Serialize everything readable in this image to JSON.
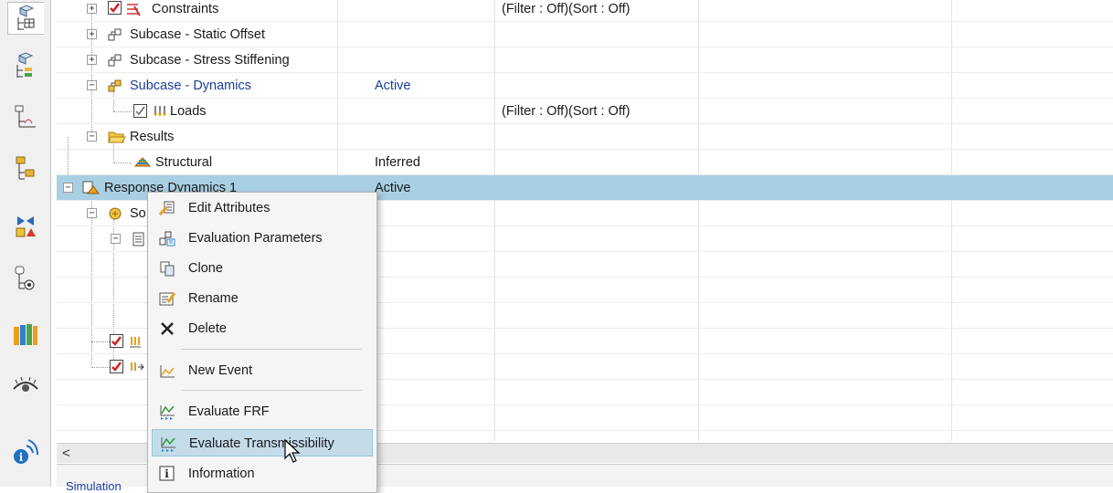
{
  "resource_bar": {
    "icons": [
      "simulation-navigator-icon",
      "constraint-navigator-icon",
      "assembly-navigator-icon",
      "part-navigator-icon",
      "reuse-library-icon",
      "sensors-icon",
      "roles-library-icon",
      "visualization-icon",
      "help-info-icon"
    ]
  },
  "tree": {
    "rows": [
      {
        "label": "Constraints",
        "col2": "",
        "col3": "(Filter : Off)(Sort : Off)"
      },
      {
        "label": "Subcase - Static Offset",
        "col2": "",
        "col3": ""
      },
      {
        "label": "Subcase - Stress Stiffening",
        "col2": "",
        "col3": ""
      },
      {
        "label": "Subcase - Dynamics",
        "col2": "Active",
        "col3": ""
      },
      {
        "label": "Loads",
        "col2": "",
        "col3": "(Filter : Off)(Sort : Off)"
      },
      {
        "label": "Results",
        "col2": "",
        "col3": ""
      },
      {
        "label": "Structural",
        "col2": "Inferred",
        "col3": ""
      },
      {
        "label": "Response Dynamics 1",
        "col2": "Active",
        "col3": ""
      },
      {
        "label": "So",
        "col2": "",
        "col3": ""
      }
    ]
  },
  "context_menu": {
    "items": [
      {
        "label": "Edit Attributes",
        "icon": "edit-attributes-icon"
      },
      {
        "label": "Evaluation Parameters",
        "icon": "evaluation-parameters-icon"
      },
      {
        "label": "Clone",
        "icon": "clone-icon"
      },
      {
        "label": "Rename",
        "icon": "rename-icon"
      },
      {
        "label": "Delete",
        "icon": "delete-icon"
      },
      {
        "label": "New Event",
        "icon": "new-event-icon"
      },
      {
        "label": "Evaluate FRF",
        "icon": "evaluate-frf-icon"
      },
      {
        "label": "Evaluate Transmissibility",
        "icon": "evaluate-transmissibility-icon"
      },
      {
        "label": "Information",
        "icon": "information-icon"
      }
    ],
    "hovered": "Evaluate Transmissibility"
  },
  "scrollbar": {
    "left_arrow": "<"
  },
  "bottom_panel": {
    "label": "Simulation"
  }
}
